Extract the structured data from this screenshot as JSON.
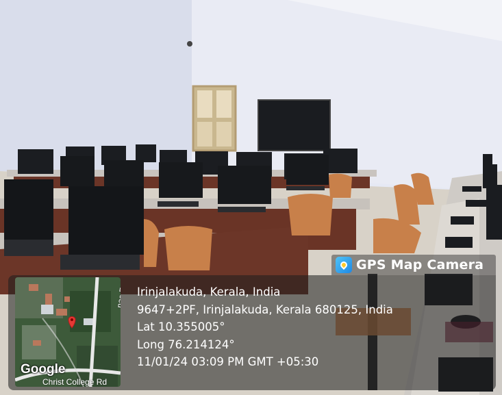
{
  "badge": {
    "title": "GPS Map Camera",
    "icon": "gps-map-camera-icon"
  },
  "location": {
    "place": "Irinjalakuda, Kerala, India",
    "address": "9647+2PF, Irinjalakuda, Kerala 680125, India",
    "lat": "Lat 10.355005°",
    "long": "Long 76.214124°",
    "datetime": "11/01/24 03:09 PM GMT +05:30"
  },
  "map": {
    "brand": "Google",
    "road_top": "nas Rd",
    "road_bottom": "Christ College Rd"
  }
}
